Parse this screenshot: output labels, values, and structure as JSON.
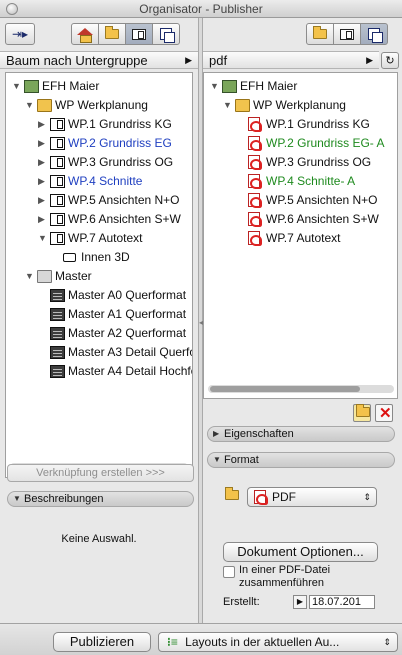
{
  "window": {
    "title": "Organisator - Publisher"
  },
  "left": {
    "view_select": "Baum nach Untergruppe",
    "tree": [
      {
        "label": "EFH Maier",
        "icon": "project-icon",
        "indent": 0,
        "expanded": true,
        "color": "#111111"
      },
      {
        "label": "WP Werkplanung",
        "icon": "folder-icon",
        "indent": 1,
        "expanded": true,
        "color": "#111111"
      },
      {
        "label": "WP.1 Grundriss KG",
        "icon": "layout-icon",
        "indent": 2,
        "collapsed": true,
        "color": "#111111"
      },
      {
        "label": "WP.2 Grundriss EG",
        "icon": "layout-icon",
        "indent": 2,
        "collapsed": true,
        "color": "#1f3fc0"
      },
      {
        "label": "WP.3 Grundriss OG",
        "icon": "layout-icon",
        "indent": 2,
        "collapsed": true,
        "color": "#111111"
      },
      {
        "label": "WP.4 Schnitte",
        "icon": "layout-icon",
        "indent": 2,
        "collapsed": true,
        "color": "#1f3fc0"
      },
      {
        "label": "WP.5 Ansichten N+O",
        "icon": "layout-icon",
        "indent": 2,
        "collapsed": true,
        "color": "#111111"
      },
      {
        "label": "WP.6 Ansichten S+W",
        "icon": "layout-icon",
        "indent": 2,
        "collapsed": true,
        "color": "#111111"
      },
      {
        "label": "WP.7 Autotext",
        "icon": "layout-icon",
        "indent": 2,
        "expanded": true,
        "color": "#111111"
      },
      {
        "label": "Innen 3D",
        "icon": "camera-icon",
        "indent": 3,
        "color": "#111111"
      },
      {
        "label": "Master",
        "icon": "folder-icon",
        "indent": 1,
        "expanded": true,
        "color": "#111111"
      },
      {
        "label": "Master A0 Querformat",
        "icon": "master-icon",
        "indent": 2,
        "color": "#111111"
      },
      {
        "label": "Master A1 Querformat",
        "icon": "master-icon",
        "indent": 2,
        "color": "#111111"
      },
      {
        "label": "Master A2 Querformat",
        "icon": "master-icon",
        "indent": 2,
        "color": "#111111"
      },
      {
        "label": "Master A3 Detail Querfor",
        "icon": "master-icon",
        "indent": 2,
        "color": "#111111"
      },
      {
        "label": "Master A4 Detail Hochfor",
        "icon": "master-icon",
        "indent": 2,
        "color": "#111111"
      }
    ],
    "link_button": "Verknüpfung erstellen >>>",
    "descriptions_header": "Beschreibungen",
    "no_selection": "Keine Auswahl."
  },
  "right": {
    "set_select": "pdf",
    "tree": [
      {
        "label": "EFH Maier",
        "icon": "project-icon",
        "indent": 0,
        "expanded": true,
        "color": "#111111"
      },
      {
        "label": "WP Werkplanung",
        "icon": "folder-icon",
        "indent": 1,
        "expanded": true,
        "color": "#111111"
      },
      {
        "label": "WP.1 Grundriss KG",
        "icon": "pdf-icon",
        "indent": 2,
        "color": "#111111"
      },
      {
        "label": "WP.2 Grundriss EG- A",
        "icon": "pdf-icon",
        "indent": 2,
        "color": "#1e8a1e"
      },
      {
        "label": "WP.3 Grundriss OG",
        "icon": "pdf-icon",
        "indent": 2,
        "color": "#111111"
      },
      {
        "label": "WP.4 Schnitte- A",
        "icon": "pdf-icon",
        "indent": 2,
        "color": "#1e8a1e"
      },
      {
        "label": "WP.5 Ansichten N+O",
        "icon": "pdf-icon",
        "indent": 2,
        "color": "#111111"
      },
      {
        "label": "WP.6 Ansichten S+W",
        "icon": "pdf-icon",
        "indent": 2,
        "color": "#111111"
      },
      {
        "label": "WP.7 Autotext",
        "icon": "pdf-icon",
        "indent": 2,
        "color": "#111111"
      }
    ],
    "properties_header": "Eigenschaften",
    "format_header": "Format",
    "format_value": "PDF",
    "doc_options_button": "Dokument Optionen...",
    "merge_checkbox_label": "In einer PDF-Datei zusammenführen",
    "merge_checked": false,
    "created_label": "Erstellt:",
    "created_value": "18.07.201"
  },
  "footer": {
    "publish_button": "Publizieren",
    "scope_select": "Layouts in der aktuellen Au..."
  }
}
